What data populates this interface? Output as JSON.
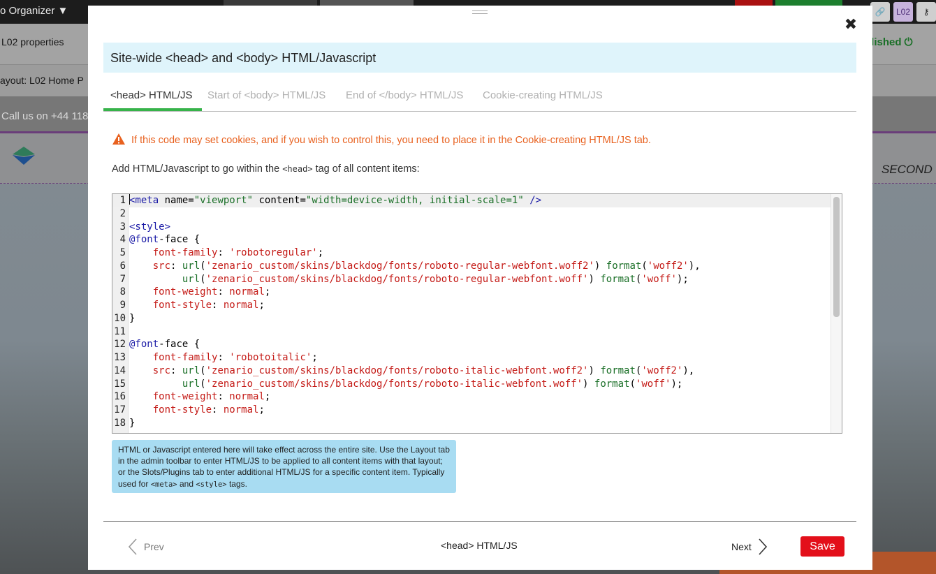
{
  "background": {
    "org_menu": "o Organizer ▼",
    "properties": "L02 properties",
    "layout": "ayout: L02 Home P",
    "call_us": "Call us on +44 118",
    "published": "blished",
    "second": "SECOND",
    "l02_badge": "L02"
  },
  "modal": {
    "title": "Site-wide <head> and <body> HTML/Javascript",
    "tabs": [
      {
        "label": "<head> HTML/JS",
        "active": true
      },
      {
        "label": "Start of <body> HTML/JS",
        "active": false
      },
      {
        "label": "End of </body> HTML/JS",
        "active": false
      },
      {
        "label": "Cookie-creating HTML/JS",
        "active": false
      }
    ],
    "warning": "If this code may set cookies, and if you wish to control this, you need to place it in the Cookie-creating HTML/JS tab.",
    "intro_before": "Add HTML/Javascript to go within the ",
    "intro_code": "<head>",
    "intro_after": " tag of all content items:",
    "code_lines": [
      "<meta name=\"viewport\" content=\"width=device-width, initial-scale=1\" />",
      "",
      "<style>",
      "@font-face {",
      "    font-family: 'robotoregular';",
      "    src: url('zenario_custom/skins/blackdog/fonts/roboto-regular-webfont.woff2') format('woff2'),",
      "         url('zenario_custom/skins/blackdog/fonts/roboto-regular-webfont.woff') format('woff');",
      "    font-weight: normal;",
      "    font-style: normal;",
      "}",
      "",
      "@font-face {",
      "    font-family: 'robotoitalic';",
      "    src: url('zenario_custom/skins/blackdog/fonts/roboto-italic-webfont.woff2') format('woff2'),",
      "         url('zenario_custom/skins/blackdog/fonts/roboto-italic-webfont.woff') format('woff');",
      "    font-weight: normal;",
      "    font-style: normal;",
      "}"
    ],
    "help_text_1": "HTML or Javascript entered here will take effect across the entire site. Use the Layout tab in the admin toolbar to enter HTML/JS to be applied to all content items with that layout; or the Slots/Plugins tab to enter additional HTML/JS for a specific content item. Typically used for ",
    "help_code_1": "<meta>",
    "help_text_2": " and ",
    "help_code_2": "<style>",
    "help_text_3": " tags.",
    "footer": {
      "prev_label": "Prev",
      "center_label": "<head> HTML/JS",
      "next_label": "Next",
      "save_label": "Save"
    }
  }
}
